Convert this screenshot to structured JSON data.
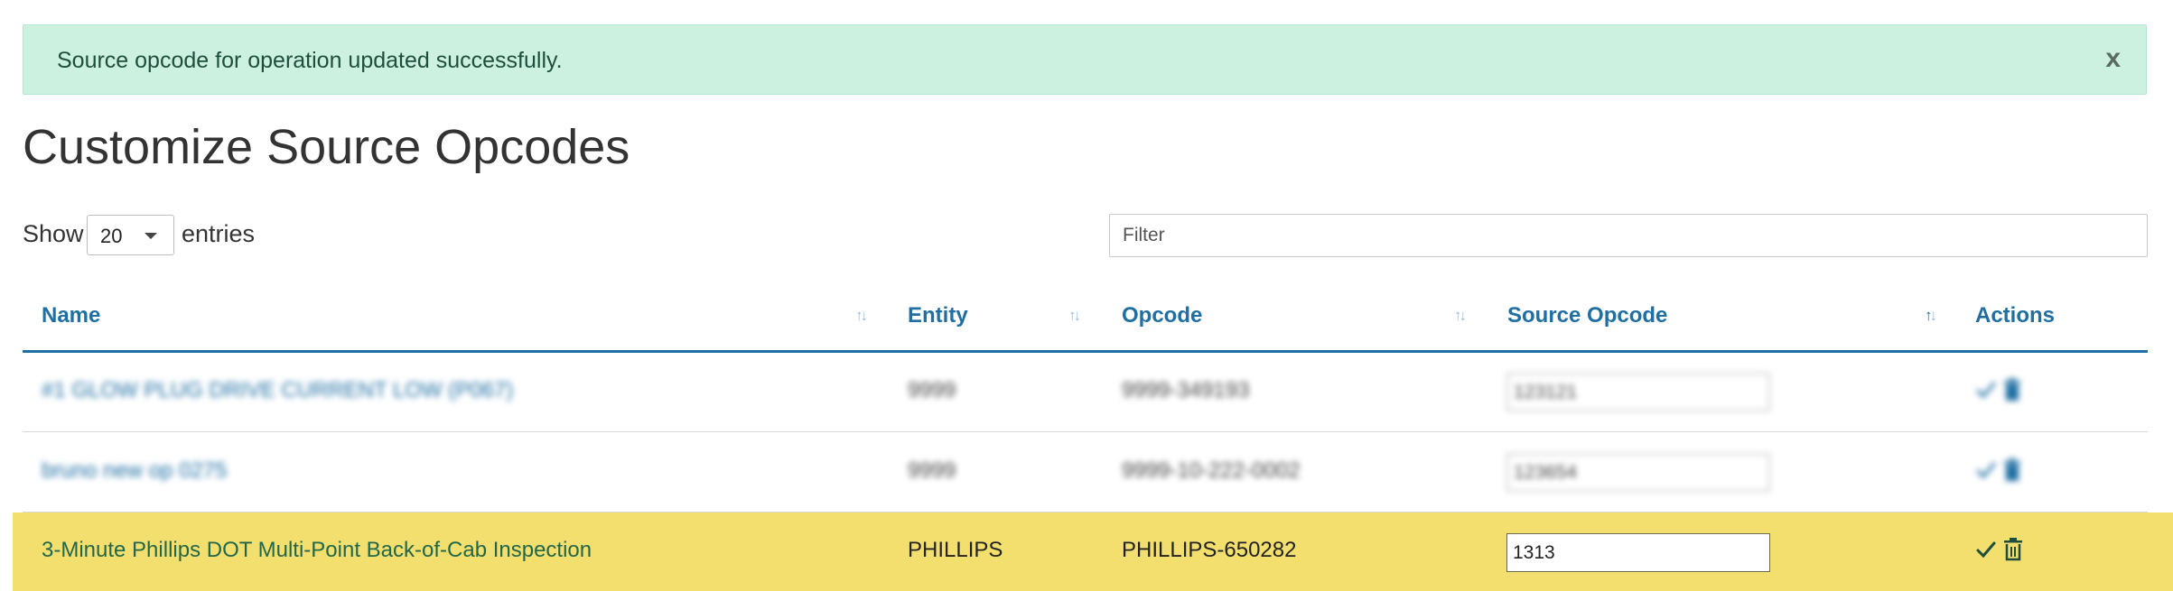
{
  "alert": {
    "message": "Source opcode for operation updated successfully.",
    "close_label": "x"
  },
  "page": {
    "title": "Customize Source Opcodes"
  },
  "table_controls": {
    "show_label": "Show",
    "entries_label": "entries",
    "page_length": "20",
    "filter_placeholder": "Filter"
  },
  "columns": [
    {
      "label": "Name"
    },
    {
      "label": "Entity"
    },
    {
      "label": "Opcode"
    },
    {
      "label": "Source Opcode"
    },
    {
      "label": "Actions"
    }
  ],
  "sort": {
    "active_column": "Source Opcode",
    "direction": "ascending"
  },
  "rows": [
    {
      "name": "#1 GLOW PLUG DRIVE CURRENT LOW (P067)",
      "entity": "9999",
      "opcode": "9999-349193",
      "source_opcode": "123121",
      "blurred": true
    },
    {
      "name": "bruno new op 0275",
      "entity": "9999",
      "opcode": "9999-10-222-0002",
      "source_opcode": "123654",
      "blurred": true
    },
    {
      "name": "3-Minute Phillips DOT Multi-Point Back-of-Cab Inspection",
      "entity": "PHILLIPS",
      "opcode": "PHILLIPS-650282",
      "source_opcode": "1313",
      "highlighted": true
    }
  ],
  "icons": {
    "save": "check-icon",
    "delete": "trash-icon"
  },
  "colors": {
    "alert_bg": "#cdf1e1",
    "link": "#1f6fa3",
    "highlight_row": "#f3df6e",
    "highlight_text": "#22674a"
  }
}
